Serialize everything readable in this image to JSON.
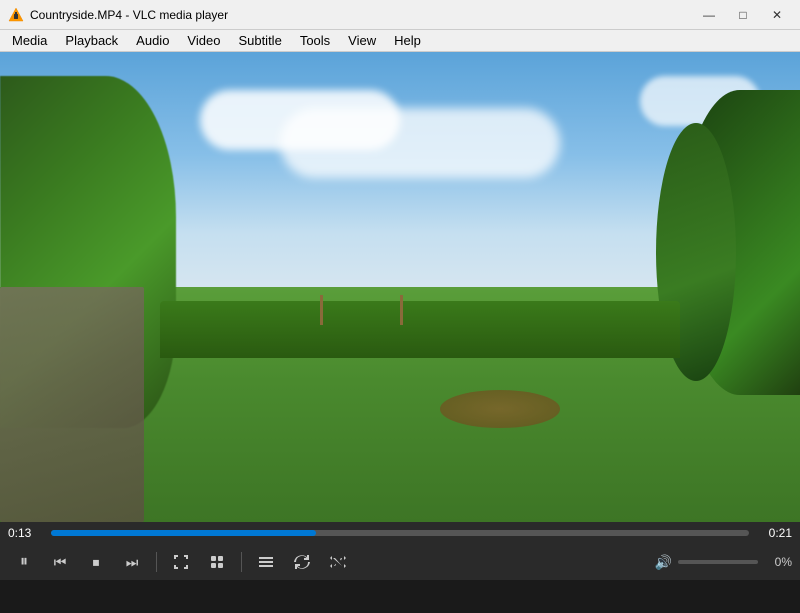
{
  "window": {
    "title": "Countryside.MP4 - VLC media player",
    "icon": "vlc-cone-icon"
  },
  "title_controls": {
    "minimize": "—",
    "maximize": "□",
    "close": "✕"
  },
  "menu": {
    "items": [
      "Media",
      "Playback",
      "Audio",
      "Video",
      "Subtitle",
      "Tools",
      "View",
      "Help"
    ]
  },
  "playback": {
    "current_time": "0:13",
    "total_time": "0:21",
    "progress_percent": 38,
    "volume_percent": 0,
    "volume_label": "0%"
  },
  "controls": {
    "pause_icon": "⏸",
    "prev_icon": "⏮",
    "stop_icon": "⏹",
    "next_icon": "⏭",
    "fullscreen_icon": "⛶",
    "extended_icon": "⊞",
    "toggle_playlist_icon": "≡",
    "loop_icon": "↺",
    "random_icon": "⇄",
    "volume_icon": "🔊"
  }
}
